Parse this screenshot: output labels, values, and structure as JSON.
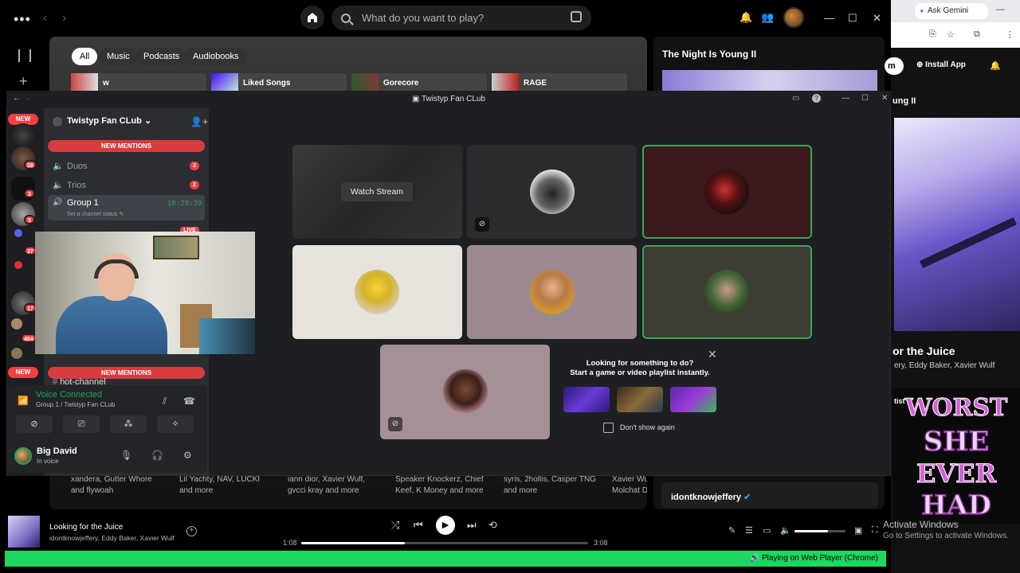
{
  "spotify": {
    "search_placeholder": "What do you want to play?",
    "chips": [
      "All",
      "Music",
      "Podcasts",
      "Audiobooks"
    ],
    "quick": [
      "w",
      "Liked Songs",
      "Gorecore",
      "RAGE"
    ],
    "right_title": "The Night Is Young II",
    "artist_rows": [
      [
        "xandera, Gutter Whore",
        "and flywoah"
      ],
      [
        "Lil Yachty, NAV, LUCKI",
        "and more"
      ],
      [
        "iann dior, Xavier Wulf,",
        "gvcci kray and more"
      ],
      [
        "Speaker Knockerz, Chief",
        "Keef, K Money and more"
      ],
      [
        "syris, 2hollis, Casper TNG",
        "and more"
      ],
      [
        "Xavier Wu",
        "Molchat D"
      ]
    ],
    "np_card_name": "idontknowjeffery",
    "now_playing": {
      "title": "Looking for the Juice",
      "artists": "idontknowjeffery, Eddy Baker, Xavier Wulf",
      "elapsed": "1:08",
      "duration": "3:08",
      "progress": 0.36,
      "volume": 0.65
    },
    "device_bar": "Playing on Web Player (Chrome)",
    "colors": {
      "accent": "#1ed760"
    }
  },
  "chrome": {
    "tab_title": "Ask Gemini",
    "install": "Install App",
    "heading": "ung II",
    "track_title": "or the Juice",
    "track_artists": "ery, Eddy Baker, Xavier Wulf",
    "artist_label": "tist",
    "poster_lines": [
      "WORST",
      "SHE",
      "EVER",
      "HAD"
    ],
    "activate1": "Activate Windows",
    "activate2": "Go to Settings to activate Windows."
  },
  "discord": {
    "window_title": "Twistyp Fan CLub",
    "server_name": "Twistyp Fan CLub",
    "new_badge": "NEW",
    "new_mentions": "NEW MENTIONS",
    "guild_badges": [
      "28",
      "3",
      "5",
      "37",
      "17",
      "404",
      "1"
    ],
    "channels": [
      {
        "name": "Duos",
        "badge": "2"
      },
      {
        "name": "Trios",
        "badge": "2"
      }
    ],
    "group": {
      "name": "Group 1",
      "time": "10:29:39",
      "status": "Set a channel status"
    },
    "live_badge": "LIVE",
    "hot_channel": "hot-channel",
    "voice": {
      "title": "Voice Connected",
      "sub": "Group 1 / Twistyp Fan CLub"
    },
    "user": {
      "name": "Big David",
      "status": "In voice"
    },
    "watch_stream": "Watch Stream",
    "activity": {
      "title_line1": "Looking for something to do?",
      "title_line2": "Start a game or video playlist instantly.",
      "dont_show": "Don't show again"
    }
  }
}
